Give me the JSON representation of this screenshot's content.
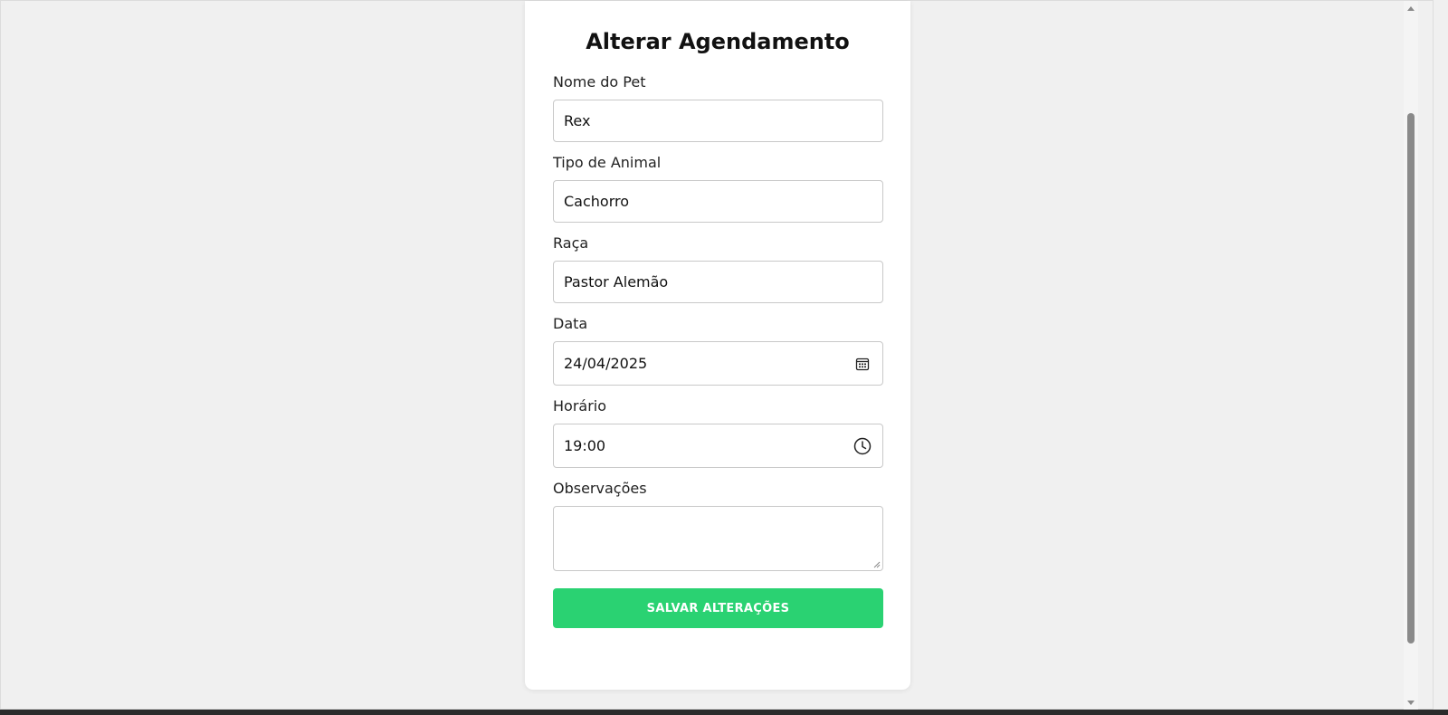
{
  "form": {
    "title": "Alterar Agendamento",
    "fields": {
      "pet_name": {
        "label": "Nome do Pet",
        "value": "Rex"
      },
      "animal_type": {
        "label": "Tipo de Animal",
        "value": "Cachorro"
      },
      "breed": {
        "label": "Raça",
        "value": "Pastor Alemão"
      },
      "date": {
        "label": "Data",
        "value": "24/04/2025",
        "icon": "calendar-icon"
      },
      "time": {
        "label": "Horário",
        "value": "19:00",
        "icon": "clock-icon"
      },
      "notes": {
        "label": "Observações",
        "value": ""
      }
    },
    "submit_label": "SALVAR ALTERAÇÕES"
  },
  "colors": {
    "background": "#f0f0f0",
    "card": "#ffffff",
    "accent": "#2ad272",
    "input_border": "#c8c8c8"
  }
}
